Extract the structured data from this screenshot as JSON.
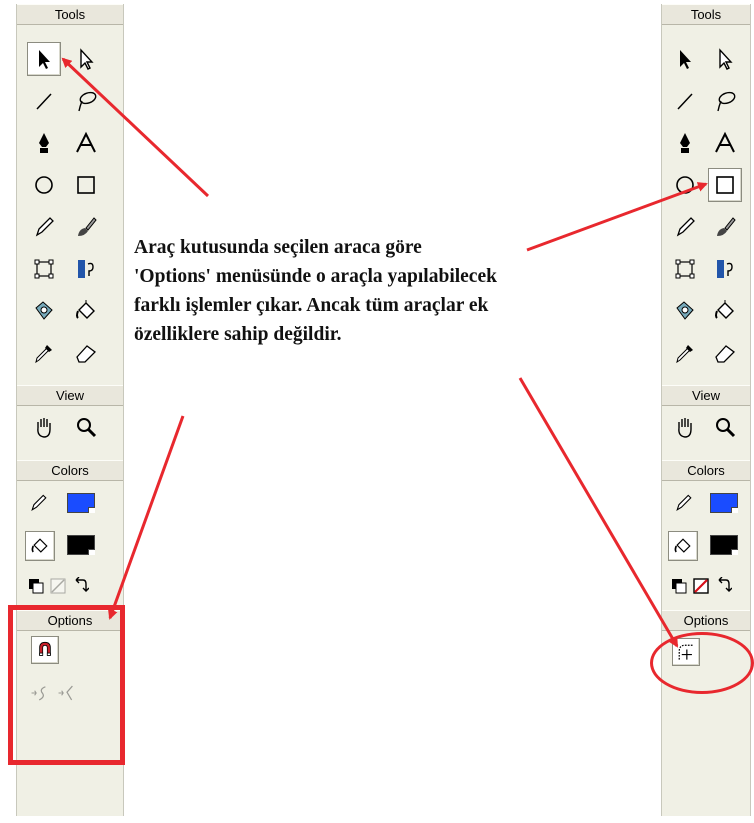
{
  "toolbar_left": {
    "tools_header": "Tools",
    "view_header": "View",
    "colors_header": "Colors",
    "options_header": "Options",
    "stroke_color": "#1a4cff",
    "fill_color": "#000000",
    "selected_tool": "arrow-tool"
  },
  "toolbar_right": {
    "tools_header": "Tools",
    "view_header": "View",
    "colors_header": "Colors",
    "options_header": "Options",
    "stroke_color": "#1a4cff",
    "fill_color": "#000000",
    "selected_tool": "rectangle-tool"
  },
  "annotation": {
    "lines": [
      "Araç kutusunda seçilen araca göre",
      "'Options' menüsünde o araçla yapılabilecek",
      "farklı işlemler çıkar. Ancak tüm araçlar ek",
      "özelliklere sahip değildir."
    ],
    "highlight_color": "#e8282e"
  }
}
